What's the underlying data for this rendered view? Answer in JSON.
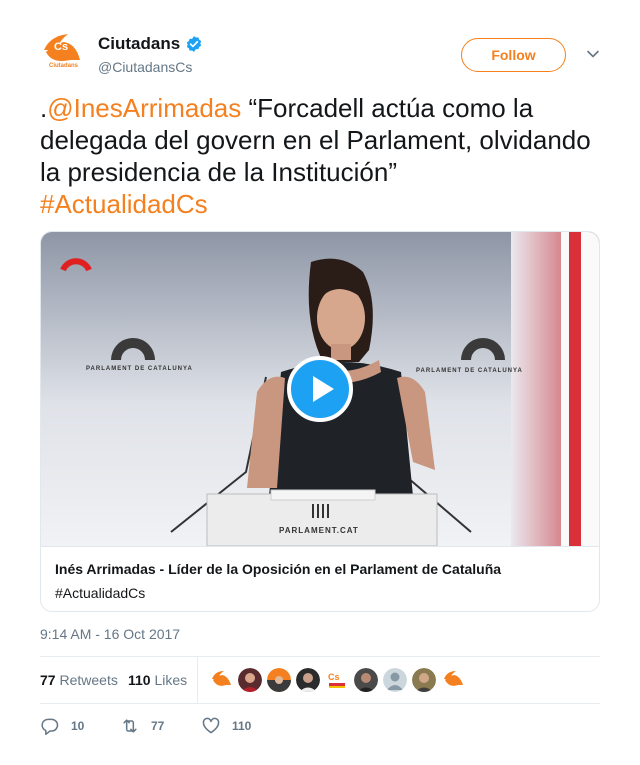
{
  "account": {
    "display_name": "Ciutadans",
    "handle": "@CiutadansCs",
    "logo_text": "Cs",
    "logo_subtext": "Ciutadans",
    "follow_label": "Follow"
  },
  "tweet": {
    "prefix": ".",
    "mention": "@InesArrimadas",
    "quote": " “Forcadell actúa como la delegada del govern en el Parlament, olvidando la presidencia de la Institución”",
    "hashtag": "#ActualidadCs"
  },
  "card": {
    "title": "Inés Arrimadas - Líder de la Oposición en el Parlament de Cataluña",
    "description": "#ActualidadCs",
    "video_banner_text": "PARLAMENT DE CATALUNYA",
    "podium_text": "PARLAMENT.CAT"
  },
  "timestamp": "9:14 AM - 16 Oct 2017",
  "stats": {
    "retweets_count": "77",
    "retweets_label": "Retweets",
    "likes_count": "110",
    "likes_label": "Likes"
  },
  "actions": {
    "reply_count": "10",
    "retweet_count": "77",
    "like_count": "110"
  },
  "colors": {
    "accent": "#f4801f",
    "verified": "#1da1f2",
    "muted": "#657786"
  }
}
